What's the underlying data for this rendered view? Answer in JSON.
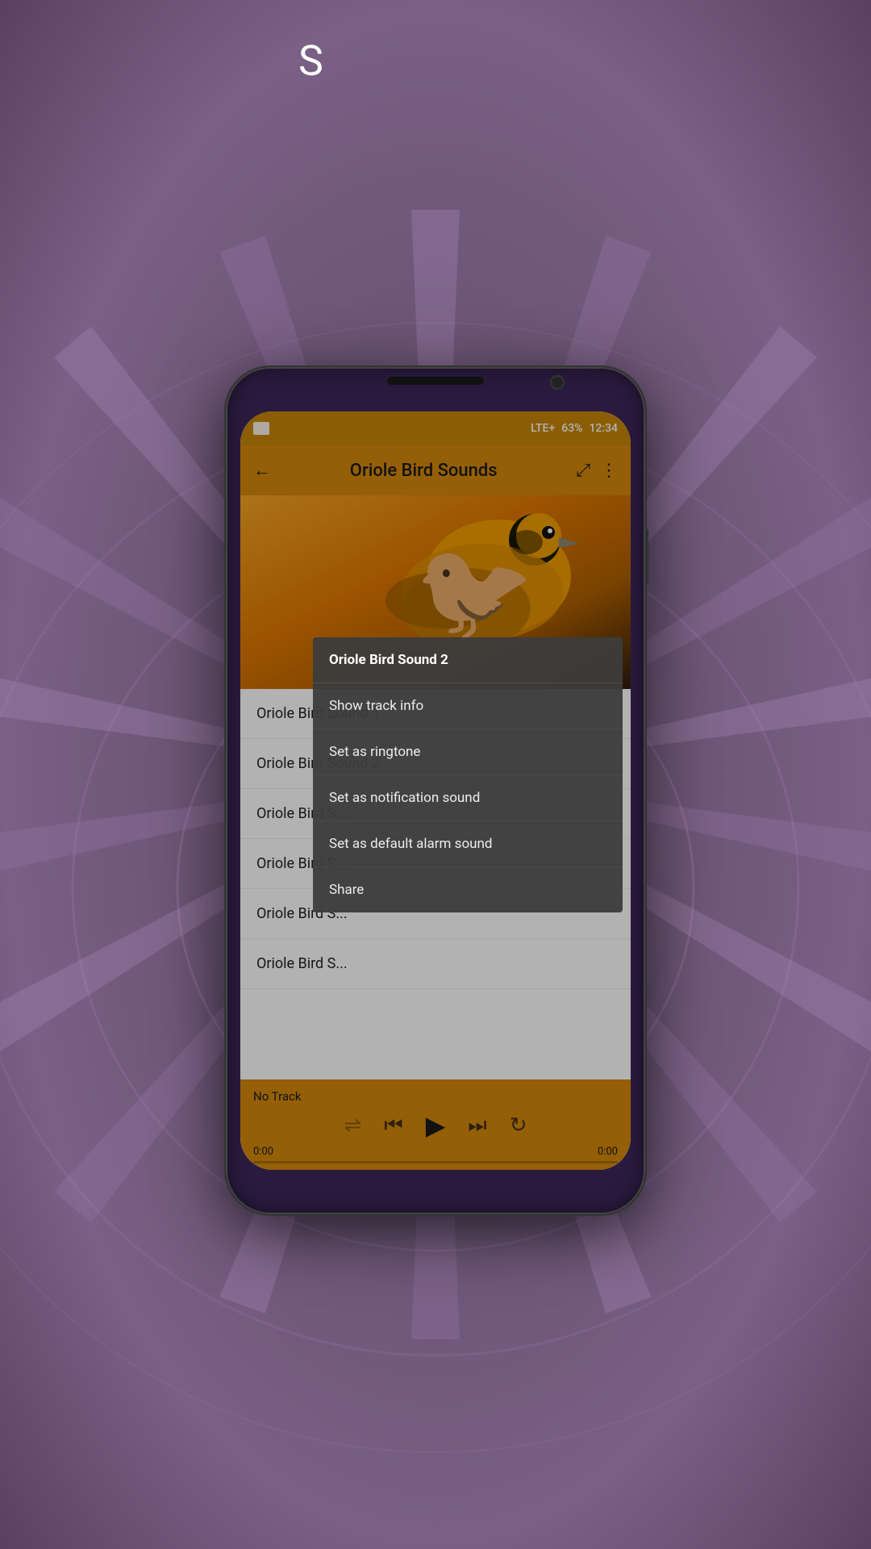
{
  "background": {
    "letter": "S"
  },
  "status_bar": {
    "signal": "LTE+",
    "battery": "63%",
    "time": "12:34"
  },
  "app_bar": {
    "title": "Oriole Bird Sounds",
    "back_label": "←",
    "share_label": "⤢",
    "menu_label": "⋮"
  },
  "sound_items": [
    {
      "label": "Oriole Bird Sound 1"
    },
    {
      "label": "Oriole Bird Sound 2"
    },
    {
      "label": "Oriole Bird S..."
    },
    {
      "label": "Oriole Bird S..."
    },
    {
      "label": "Oriole Bird S..."
    },
    {
      "label": "Oriole Bird S..."
    }
  ],
  "context_menu": {
    "title": "Oriole Bird Sound 2",
    "items": [
      {
        "label": "Show track info"
      },
      {
        "label": "Set as ringtone"
      },
      {
        "label": "Set as notification sound"
      },
      {
        "label": "Set as default alarm sound"
      },
      {
        "label": "Share"
      }
    ]
  },
  "player": {
    "no_track": "No Track",
    "time_start": "0:00",
    "time_end": "0:00"
  }
}
